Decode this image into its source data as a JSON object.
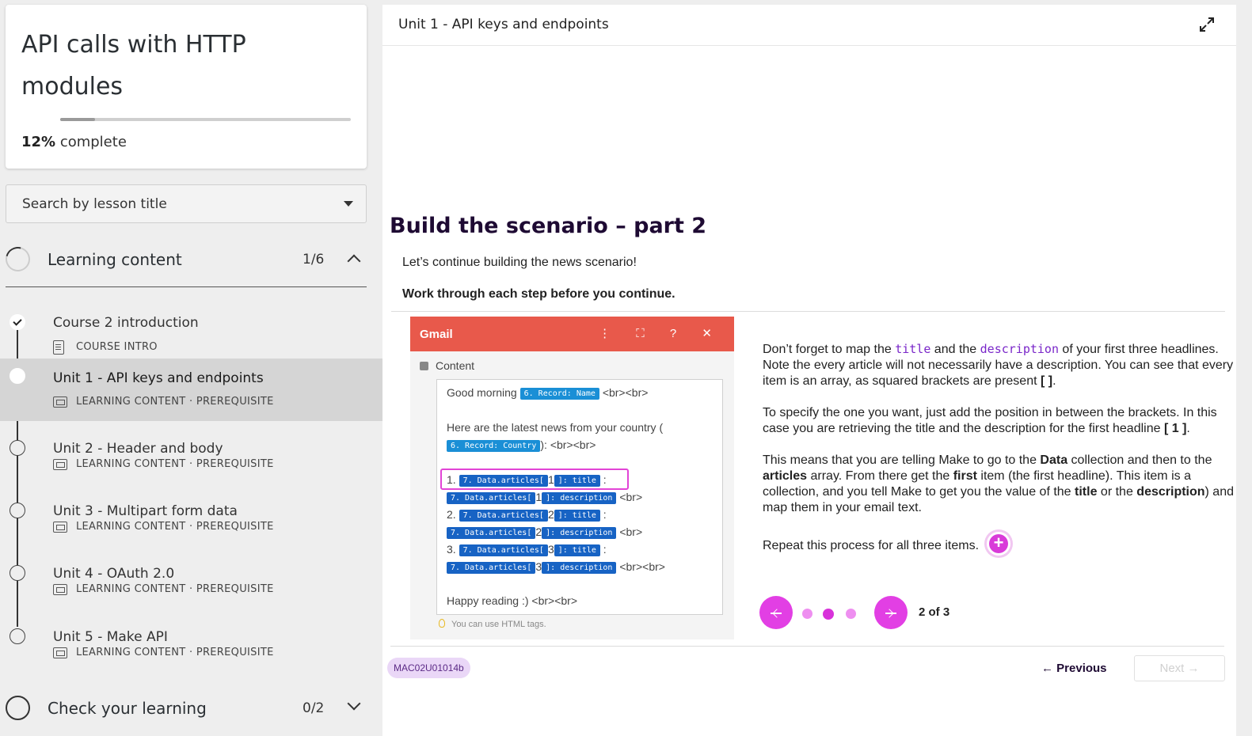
{
  "course": {
    "title": "API calls with HTTP modules",
    "progress_percent": 12,
    "progress_value": "12%",
    "progress_label": " complete"
  },
  "search": {
    "placeholder": "Search by lesson title"
  },
  "sections": [
    {
      "label": "Learning content",
      "count": "1/6",
      "expanded": true
    },
    {
      "label": "Check your learning",
      "count": "0/2",
      "expanded": false
    }
  ],
  "lessons": [
    {
      "title": "Course 2 introduction",
      "meta": "COURSE INTRO",
      "done": true
    },
    {
      "title": "Unit 1 - API keys and endpoints",
      "meta": "LEARNING CONTENT · PREREQUISITE",
      "active": true
    },
    {
      "title": "Unit 2 - Header and body",
      "meta": "LEARNING CONTENT · PREREQUISITE"
    },
    {
      "title": "Unit 3 - Multipart form data",
      "meta": "LEARNING CONTENT · PREREQUISITE"
    },
    {
      "title": "Unit 4 - OAuth 2.0",
      "meta": "LEARNING CONTENT · PREREQUISITE"
    },
    {
      "title": "Unit 5 - Make API",
      "meta": "LEARNING CONTENT · PREREQUISITE"
    }
  ],
  "main": {
    "unit_title": "Unit 1 - API keys and endpoints",
    "lesson_title": "Build the scenario – part 2",
    "intro": "Let’s continue building the news scenario!",
    "instruction": "Work through each step before you continue.",
    "gmail": {
      "title": "Gmail",
      "icons": "⋮ ⛶ ? ✕",
      "content_label": "Content",
      "greeting": "Good morning",
      "record_name": "6. Record: Name",
      "br2": "<br><br>",
      "news_line": "Here are the latest news from your country (",
      "record_country": "6. Record: Country",
      "country_tail": "): <br><br>",
      "articles": [
        {
          "num": "1.",
          "idx": "1"
        },
        {
          "num": "2.",
          "idx": "2"
        },
        {
          "num": "3.",
          "idx": "3"
        }
      ],
      "pill_articles": "7. Data.articles[",
      "pill_title": "]: title",
      "pill_desc": "]: description",
      "colon": ":",
      "br": "<br>",
      "closing": "Happy reading :) <br><br>",
      "hint": "You can use HTML tags."
    },
    "explain": {
      "p1_a": "Don’t forget to map the ",
      "p1_code1": "title",
      "p1_b": " and the ",
      "p1_code2": "description",
      "p1_c": " of your first three headlines. Note the every article will not necessarily have a description. You can see that every item is an array, as squared brackets are present ",
      "p1_d": "[ ]",
      "p1_e": ".",
      "p2_a": "To specify the one you want, just add the position in between the brackets. In this case you are retrieving the title and the description for the first headline ",
      "p2_b": "[ 1 ]",
      "p2_c": ".",
      "p3_a": "This means that you are telling Make to go to the ",
      "p3_b": "Data",
      "p3_c": " collection and then to the ",
      "p3_d": "articles",
      "p3_e": " array. From there get the ",
      "p3_f": "first",
      "p3_g": " item (the first headline). This item is a collection, and you tell Make to get you the value of the ",
      "p3_h": "title",
      "p3_i": " or the ",
      "p3_j": "description",
      "p3_k": ") and map them in your email text.",
      "p4": "Repeat this process for all three items."
    },
    "carousel": {
      "current": 2,
      "total": 3,
      "label": "2 of 3"
    },
    "footer": {
      "code": "MAC02U01014b",
      "previous": "← Previous",
      "next": "Next →"
    }
  },
  "colors": {
    "accent": "#e23fe4",
    "gmail_red": "#e8594b",
    "pill_blue": "#1a8fd6"
  }
}
